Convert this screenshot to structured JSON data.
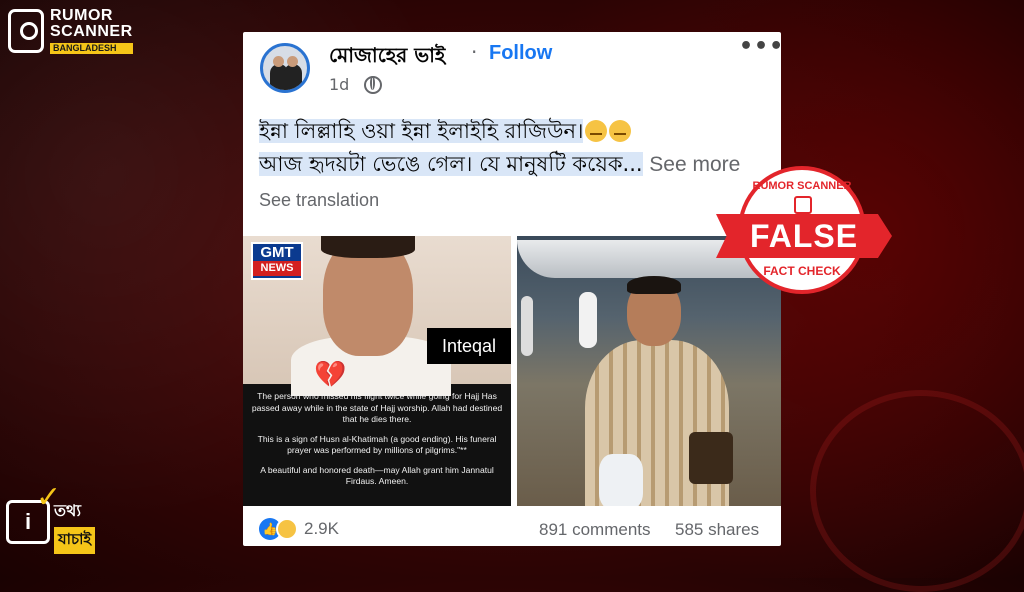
{
  "brand": {
    "line1": "RUMOR",
    "line2": "SCANNER",
    "sub": "BANGLADESH"
  },
  "badge": {
    "icon_letter": "i",
    "line1": "তথ্য",
    "line2": "যাচাই"
  },
  "post": {
    "author": "মোজাহের ভাই",
    "separator": "·",
    "follow_label": "Follow",
    "more_label": "•••",
    "time": "1d",
    "text_line1": "ইন্না লিল্লাহি ওয়া ইন্না ইলাইহি রাজিউন।",
    "text_line2": "আজ হৃদয়টা ভেঙে গেল। যে মানুষটি কয়েক...",
    "see_more": "See more",
    "see_translation": "See translation",
    "reactions_count": "2.9K",
    "comments": "891 comments",
    "shares": "585 shares"
  },
  "image_left": {
    "logo_top": "GMT",
    "logo_bottom": "NEWS",
    "overlay": "Inteqal",
    "caption_p1": "The person who missed his flight twice while going for Hajj Has passed away while in the state of Hajj worship. Allah had destined that he dies there.",
    "caption_p2": "This is a sign of Husn al-Khatimah (a good ending). His funeral prayer was performed by millions of pilgrims.\"**",
    "caption_p3": "A beautiful and honored death—may Allah grant him Jannatul Firdaus. Ameen."
  },
  "stamp": {
    "top": "RUMOR SCANNER",
    "verdict": "FALSE",
    "bottom": "FACT CHECK"
  },
  "colors": {
    "facebook_blue": "#1877f2",
    "stamp_red": "#e3252b",
    "brand_yellow": "#f5c518"
  },
  "icons": [
    "globe-icon",
    "like-icon",
    "sad-icon",
    "broken-heart-icon",
    "more-options-icon"
  ]
}
